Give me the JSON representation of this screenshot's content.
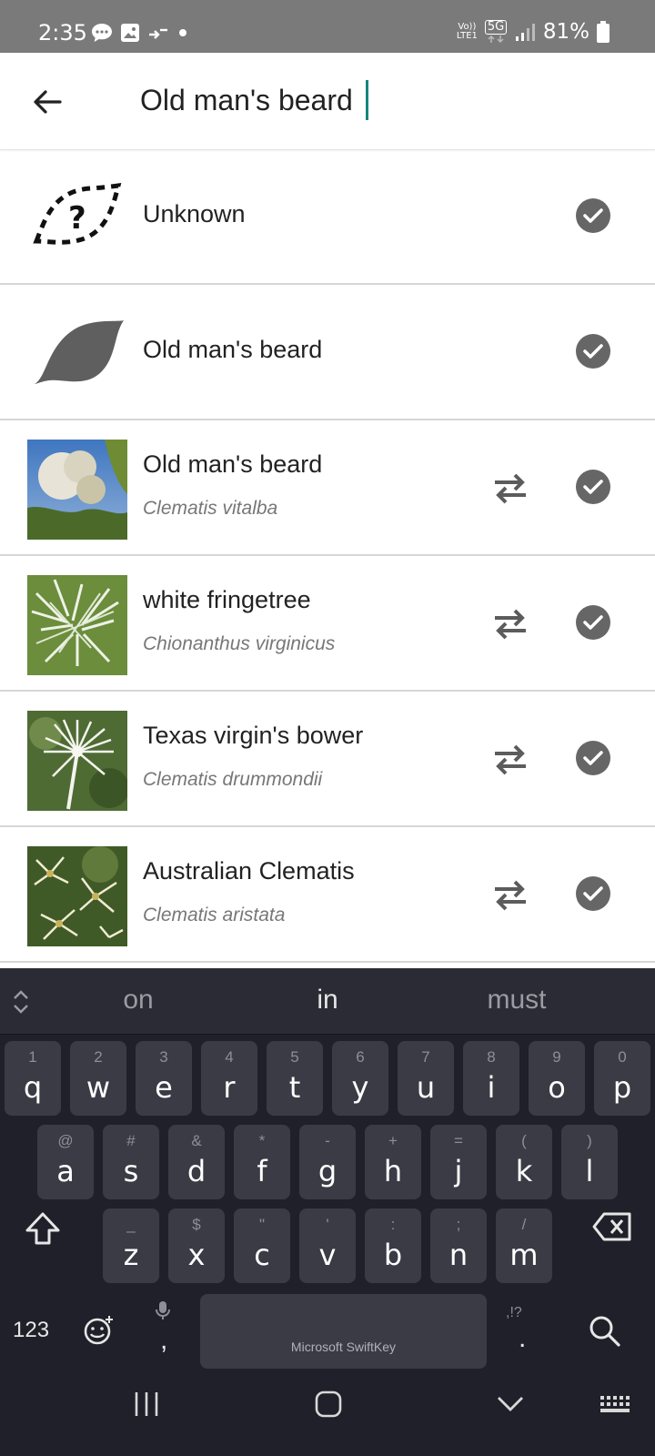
{
  "status_bar": {
    "time": "2:35",
    "network_top": "Vo))",
    "network_bottom": "LTE1",
    "network_type": "5G",
    "battery": "81%"
  },
  "search": {
    "query": "Old man's beard"
  },
  "results": [
    {
      "name": "Unknown",
      "scientific": "",
      "icon": "unknown-taxon-icon"
    },
    {
      "name": "Old man's beard",
      "scientific": "",
      "icon": "leaf-icon"
    },
    {
      "name": "Old man's beard",
      "scientific": "Clematis vitalba",
      "icon": "taxon-photo"
    },
    {
      "name": "white fringetree",
      "scientific": "Chionanthus virginicus",
      "icon": "taxon-photo"
    },
    {
      "name": "Texas virgin's bower",
      "scientific": "Clematis drummondii",
      "icon": "taxon-photo"
    },
    {
      "name": "Australian Clematis",
      "scientific": "Clematis aristata",
      "icon": "taxon-photo"
    }
  ],
  "keyboard": {
    "suggestions": [
      "on",
      "in",
      "must"
    ],
    "row1": [
      {
        "hint": "1",
        "key": "q"
      },
      {
        "hint": "2",
        "key": "w"
      },
      {
        "hint": "3",
        "key": "e"
      },
      {
        "hint": "4",
        "key": "r"
      },
      {
        "hint": "5",
        "key": "t"
      },
      {
        "hint": "6",
        "key": "y"
      },
      {
        "hint": "7",
        "key": "u"
      },
      {
        "hint": "8",
        "key": "i"
      },
      {
        "hint": "9",
        "key": "o"
      },
      {
        "hint": "0",
        "key": "p"
      }
    ],
    "row2": [
      {
        "hint": "@",
        "key": "a"
      },
      {
        "hint": "#",
        "key": "s"
      },
      {
        "hint": "&",
        "key": "d"
      },
      {
        "hint": "*",
        "key": "f"
      },
      {
        "hint": "-",
        "key": "g"
      },
      {
        "hint": "+",
        "key": "h"
      },
      {
        "hint": "=",
        "key": "j"
      },
      {
        "hint": "(",
        "key": "k"
      },
      {
        "hint": ")",
        "key": "l"
      }
    ],
    "row3": [
      {
        "hint": "_",
        "key": "z"
      },
      {
        "hint": "$",
        "key": "x"
      },
      {
        "hint": "\"",
        "key": "c"
      },
      {
        "hint": "'",
        "key": "v"
      },
      {
        "hint": ":",
        "key": "b"
      },
      {
        "hint": ";",
        "key": "n"
      },
      {
        "hint": "/",
        "key": "m"
      }
    ],
    "numbers_key": "123",
    "comma_key": ",",
    "period_hint": ",!?",
    "period_key": ".",
    "space_label": "Microsoft SwiftKey"
  }
}
